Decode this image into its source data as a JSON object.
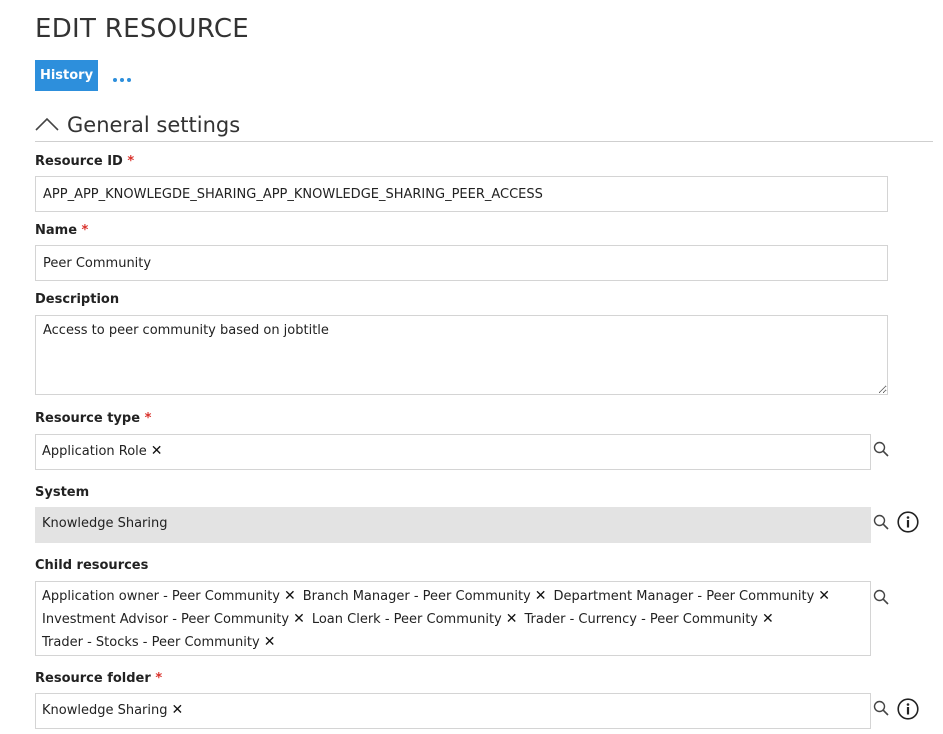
{
  "page": {
    "title": "EDIT RESOURCE"
  },
  "toolbar": {
    "history_label": "History",
    "more_icon": "more-horizontal-icon"
  },
  "section": {
    "title": "General settings",
    "collapse_icon": "chevron-up-icon"
  },
  "fields": {
    "resource_id": {
      "label": "Resource ID",
      "required": "*",
      "value": "APP_APP_KNOWLEGDE_SHARING_APP_KNOWLEDGE_SHARING_PEER_ACCESS"
    },
    "name": {
      "label": "Name",
      "required": "*",
      "value": "Peer Community"
    },
    "description": {
      "label": "Description",
      "value": "Access to peer community based on jobtitle"
    },
    "resource_type": {
      "label": "Resource type",
      "required": "*",
      "tags": [
        "Application Role"
      ]
    },
    "system": {
      "label": "System",
      "value": "Knowledge Sharing"
    },
    "child_resources": {
      "label": "Child resources",
      "tags": [
        "Application owner - Peer Community",
        "Branch Manager - Peer Community",
        "Department Manager - Peer Community",
        "Investment Advisor - Peer Community",
        "Loan Clerk - Peer Community",
        "Trader - Currency - Peer Community",
        "Trader - Stocks - Peer Community"
      ]
    },
    "resource_folder": {
      "label": "Resource folder",
      "required": "*",
      "tags": [
        "Knowledge Sharing"
      ]
    }
  },
  "icons": {
    "remove": "✕",
    "search": "search-icon",
    "info": "info-icon"
  },
  "colors": {
    "accent": "#2d8fdc",
    "required": "#d9312b",
    "readonly_bg": "#e3e3e3"
  }
}
